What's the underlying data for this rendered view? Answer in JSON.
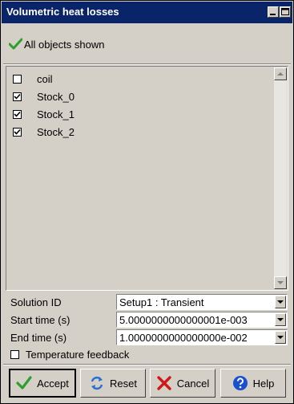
{
  "window": {
    "title": "Volumetric heat losses"
  },
  "status": {
    "text": "All objects shown"
  },
  "objects": [
    {
      "label": "coil",
      "checked": false
    },
    {
      "label": "Stock_0",
      "checked": true
    },
    {
      "label": "Stock_1",
      "checked": true
    },
    {
      "label": "Stock_2",
      "checked": true
    }
  ],
  "form": {
    "solution_id": {
      "label": "Solution ID",
      "value": "Setup1 : Transient"
    },
    "start_time": {
      "label": "Start time (s)",
      "value": "5.0000000000000001e-003"
    },
    "end_time": {
      "label": "End time (s)",
      "value": "1.0000000000000000e-002"
    },
    "temperature_feedback": {
      "label": "Temperature feedback",
      "checked": false
    }
  },
  "buttons": {
    "accept": "Accept",
    "reset": "Reset",
    "cancel": "Cancel",
    "help": "Help"
  },
  "colors": {
    "titlebar": "#0a246a",
    "window_bg": "#d4d0c8",
    "check_green": "#2e9e2e",
    "cancel_red": "#d01818",
    "help_blue": "#1a4fd0",
    "reset_blue": "#2a6fd6"
  },
  "icons": {
    "status": "green-check-icon",
    "accept": "green-check-icon",
    "reset": "refresh-arrows-icon",
    "cancel": "red-x-icon",
    "help": "question-mark-icon"
  }
}
